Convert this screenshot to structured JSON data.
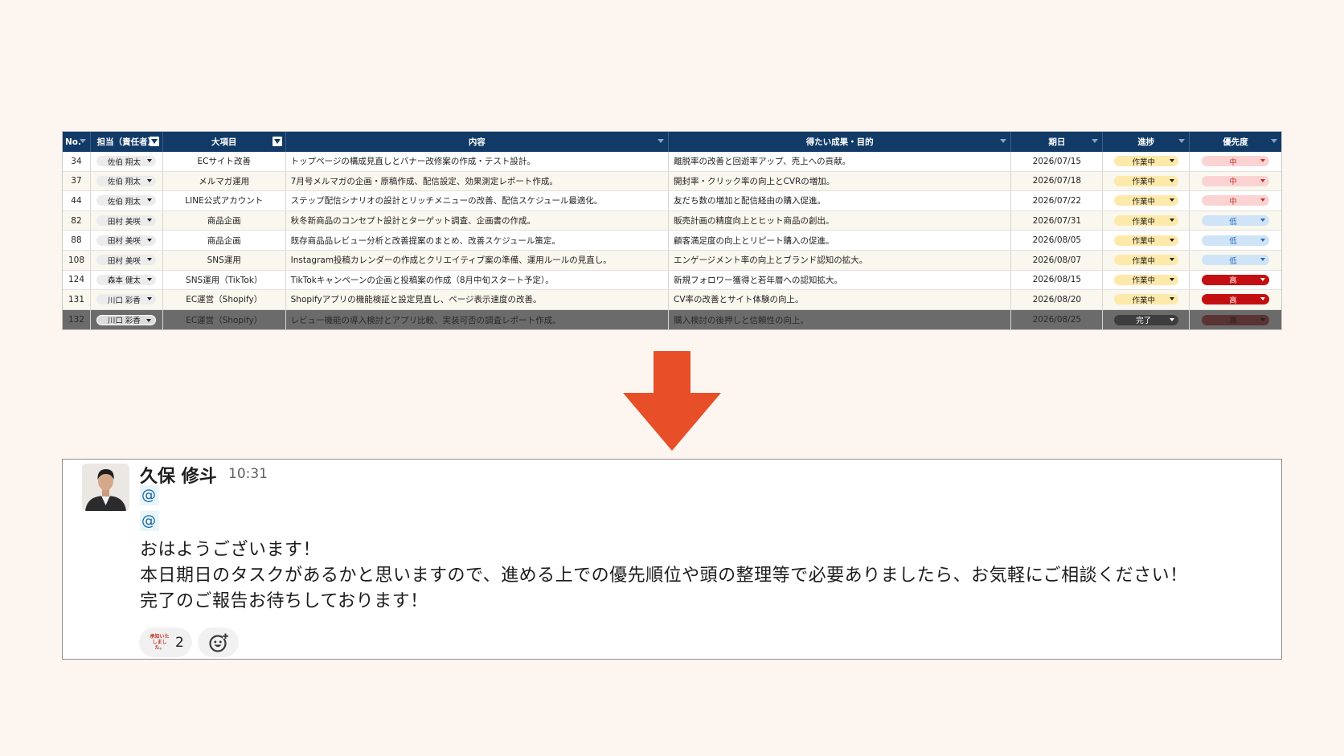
{
  "sheet": {
    "headers": [
      "No.",
      "担当（責任者）",
      "大項目",
      "内容",
      "得たい成果・目的",
      "期日",
      "進捗",
      "優先度"
    ],
    "rows": [
      {
        "no": "34",
        "person": "佐伯 翔太",
        "category": "ECサイト改善",
        "content": "トップページの構成見直しとバナー改修案の作成・テスト設計。",
        "goal": "離脱率の改善と回遊率アップ、売上への貢献。",
        "due": "2026/07/15",
        "status": "作業中",
        "priority": "中"
      },
      {
        "no": "37",
        "person": "佐伯 翔太",
        "category": "メルマガ運用",
        "content": "7月号メルマガの企画・原稿作成、配信設定、効果測定レポート作成。",
        "goal": "開封率・クリック率の向上とCVRの増加。",
        "due": "2026/07/18",
        "status": "作業中",
        "priority": "中"
      },
      {
        "no": "44",
        "person": "佐伯 翔太",
        "category": "LINE公式アカウント",
        "content": "ステップ配信シナリオの設計とリッチメニューの改善、配信スケジュール最適化。",
        "goal": "友だち数の増加と配信経由の購入促進。",
        "due": "2026/07/22",
        "status": "作業中",
        "priority": "中"
      },
      {
        "no": "82",
        "person": "田村 美咲",
        "category": "商品企画",
        "content": "秋冬新商品のコンセプト設計とターゲット調査、企画書の作成。",
        "goal": "販売計画の精度向上とヒット商品の創出。",
        "due": "2026/07/31",
        "status": "作業中",
        "priority": "低"
      },
      {
        "no": "88",
        "person": "田村 美咲",
        "category": "商品企画",
        "content": "既存商品品レビュー分析と改善提案のまとめ、改善スケジュール策定。",
        "goal": "顧客満足度の向上とリピート購入の促進。",
        "due": "2026/08/05",
        "status": "作業中",
        "priority": "低"
      },
      {
        "no": "108",
        "person": "田村 美咲",
        "category": "SNS運用",
        "content": "Instagram投稿カレンダーの作成とクリエイティブ案の準備、運用ルールの見直し。",
        "goal": "エンゲージメント率の向上とブランド認知の拡大。",
        "due": "2026/08/07",
        "status": "作業中",
        "priority": "低"
      },
      {
        "no": "124",
        "person": "森本 健太",
        "category": "SNS運用（TikTok）",
        "content": "TikTokキャンペーンの企画と投稿案の作成（8月中旬スタート予定）。",
        "goal": "新規フォロワー獲得と若年層への認知拡大。",
        "due": "2026/08/15",
        "status": "作業中",
        "priority": "高"
      },
      {
        "no": "131",
        "person": "川口 彩香",
        "category": "EC運営（Shopify）",
        "content": "Shopifyアプリの機能検証と設定見直し、ページ表示速度の改善。",
        "goal": "CV率の改善とサイト体験の向上。",
        "due": "2026/08/20",
        "status": "作業中",
        "priority": "高"
      },
      {
        "no": "132",
        "person": "川口 彩香",
        "category": "EC運営（Shopify）",
        "content": "レビュー機能の導入検討とアプリ比較、実装可否の調査レポート作成。",
        "goal": "購入検討の後押しと信頼性の向上。",
        "due": "2026/08/25",
        "status": "完了",
        "priority": "高"
      }
    ],
    "colors": {
      "header_bg": "#113a66",
      "status_working_bg": "#fde9a9",
      "status_done_bg": "#3d3d3d",
      "priority_mid_bg": "#fbd3d3",
      "priority_low_bg": "#cfe4f7",
      "priority_high_bg": "#c40f12"
    }
  },
  "arrow": {
    "icon": "arrow-down-icon",
    "color": "#e84e27"
  },
  "chat": {
    "sender": "久保 修斗",
    "time": "10:31",
    "mention_1": "@",
    "mention_2": "@",
    "message_lines": [
      "おはようございます！",
      "本日期日のタスクがあるかと思いますので、進める上での優先順位や頭の整理等で必要ありましたら、お気軽にご相談ください！",
      "完了のご報告お待ちしております！"
    ],
    "reaction": {
      "stamp_text": "承知いたしました。",
      "count": "2"
    },
    "add_reaction_icon": "add-reaction-icon"
  }
}
